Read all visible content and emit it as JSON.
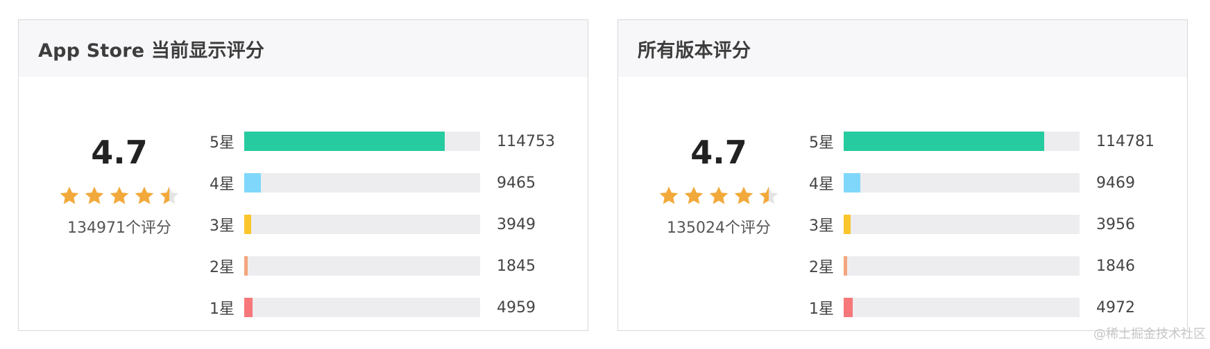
{
  "panels": [
    {
      "title": "App Store 当前显示评分",
      "score": "4.7",
      "stars_value": 4.7,
      "count_text": "134971个评分",
      "rows": [
        {
          "label": "5星",
          "value": "114753",
          "count": 114753,
          "color": "#26cba0"
        },
        {
          "label": "4星",
          "value": "9465",
          "count": 9465,
          "color": "#7fd7fb"
        },
        {
          "label": "3星",
          "value": "3949",
          "count": 3949,
          "color": "#fbc52c"
        },
        {
          "label": "2星",
          "value": "1845",
          "count": 1845,
          "color": "#f3a57d"
        },
        {
          "label": "1星",
          "value": "4959",
          "count": 4959,
          "color": "#f7777a"
        }
      ]
    },
    {
      "title": "所有版本评分",
      "score": "4.7",
      "stars_value": 4.7,
      "count_text": "135024个评分",
      "rows": [
        {
          "label": "5星",
          "value": "114781",
          "count": 114781,
          "color": "#26cba0"
        },
        {
          "label": "4星",
          "value": "9469",
          "count": 9469,
          "color": "#7fd7fb"
        },
        {
          "label": "3星",
          "value": "3956",
          "count": 3956,
          "color": "#fbc52c"
        },
        {
          "label": "2星",
          "value": "1846",
          "count": 1846,
          "color": "#f3a57d"
        },
        {
          "label": "1星",
          "value": "4972",
          "count": 4972,
          "color": "#f7777a"
        }
      ]
    }
  ],
  "star_color": "#f2a93b",
  "star_empty_color": "#e4e4e4",
  "watermark": "@稀土掘金技术社区"
}
